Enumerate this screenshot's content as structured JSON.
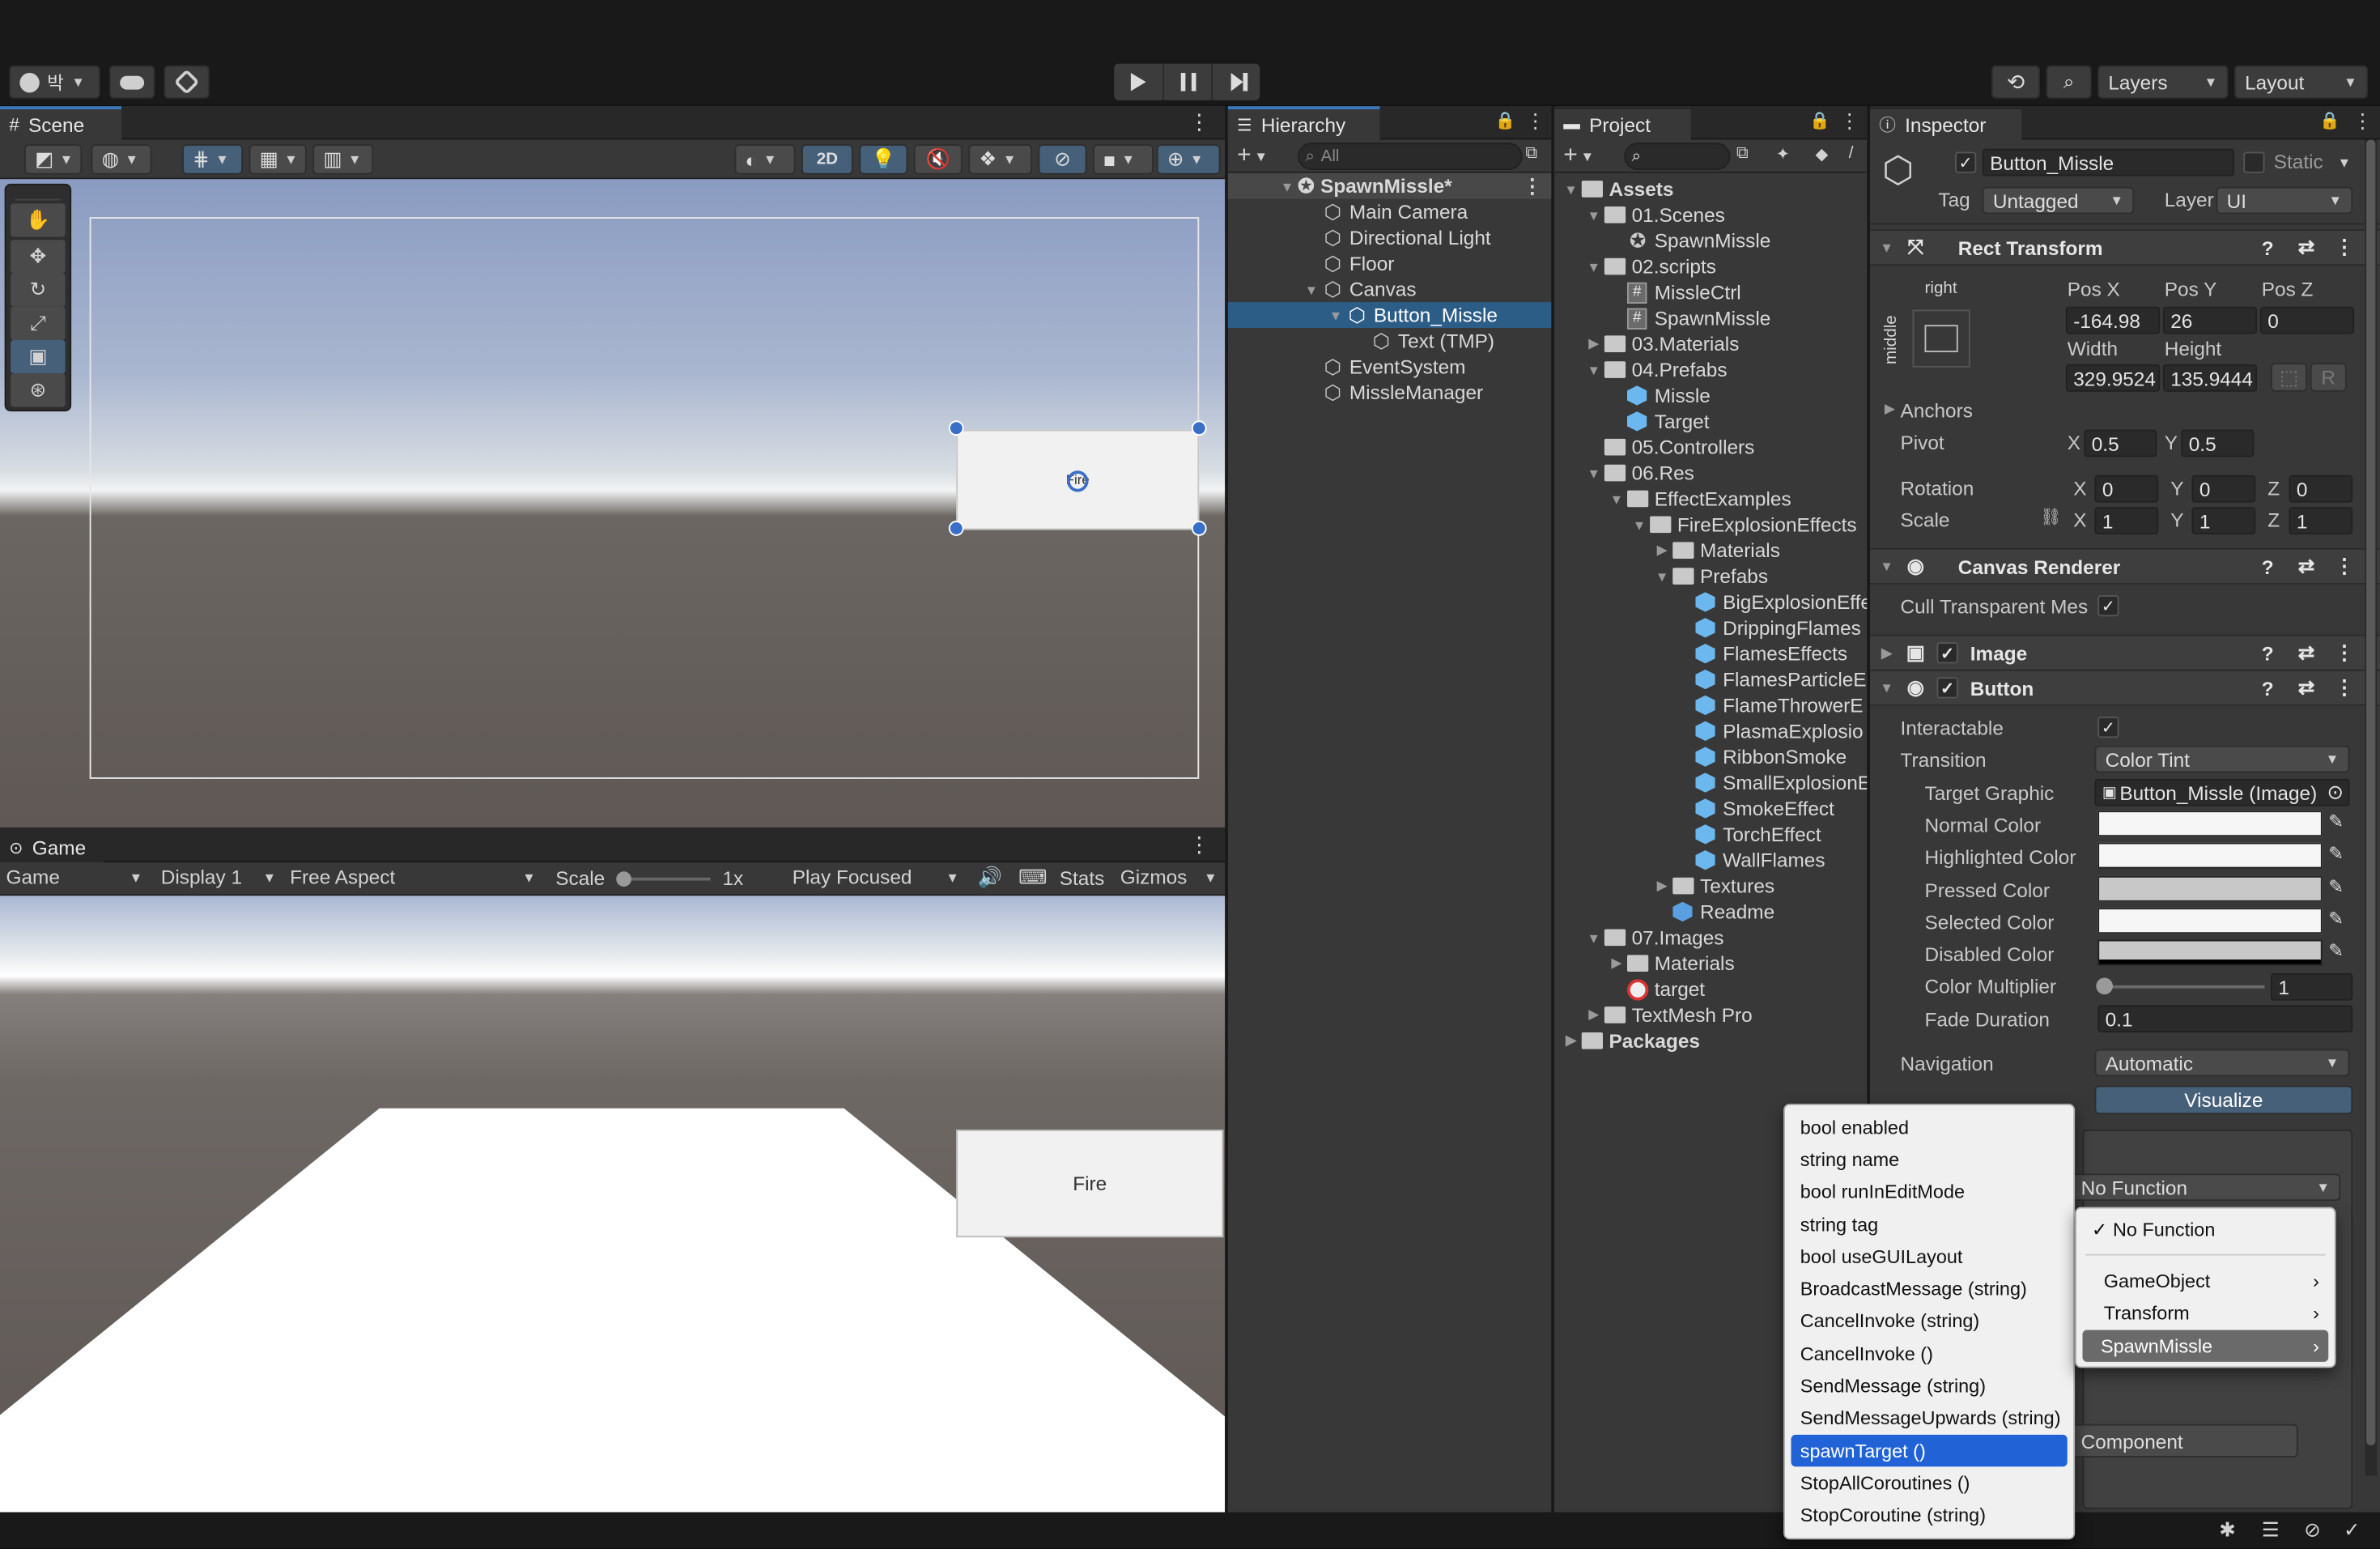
{
  "toolbar": {
    "account_icon": "account-icon",
    "account_label": "박",
    "play": "play-icon",
    "pause": "pause-icon",
    "step": "step-icon",
    "layers": "Layers",
    "layout": "Layout"
  },
  "scene": {
    "tab": "Scene",
    "btn_2d": "2D",
    "button_text": "Fire"
  },
  "game": {
    "tab": "Game",
    "mode": "Game",
    "display": "Display 1",
    "aspect": "Free Aspect",
    "scale_label": "Scale",
    "scale_value": "1x",
    "play_focused": "Play Focused",
    "stats": "Stats",
    "gizmos": "Gizmos",
    "button_text": "Fire"
  },
  "hierarchy": {
    "tab": "Hierarchy",
    "search_placeholder": "All",
    "scene_name": "SpawnMissle*",
    "items": [
      "Main Camera",
      "Directional Light",
      "Floor",
      "Canvas",
      "Button_Missle",
      "Text (TMP)",
      "EventSystem",
      "MissleManager"
    ]
  },
  "project": {
    "tab": "Project",
    "items": [
      "Assets",
      "01.Scenes",
      "SpawnMissle",
      "02.scripts",
      "MissleCtrl",
      "SpawnMissle",
      "03.Materials",
      "04.Prefabs",
      "Missle",
      "Target",
      "05.Controllers",
      "06.Res",
      "EffectExamples",
      "FireExplosionEffects",
      "Materials",
      "Prefabs",
      "BigExplosionEffe",
      "DrippingFlames",
      "FlamesEffects",
      "FlamesParticleE",
      "FlameThrowerE",
      "PlasmaExplosio",
      "RibbonSmoke",
      "SmallExplosionE",
      "SmokeEffect",
      "TorchEffect",
      "WallFlames",
      "Textures",
      "Readme",
      "07.Images",
      "Materials",
      "target",
      "TextMesh Pro",
      "Packages"
    ]
  },
  "inspector": {
    "tab": "Inspector",
    "object_name": "Button_Missle",
    "static_label": "Static",
    "tag_label": "Tag",
    "tag_value": "Untagged",
    "layer_label": "Layer",
    "layer_value": "UI",
    "rect_transform": "Rect Transform",
    "anchor_h": "right",
    "anchor_v": "middle",
    "posx_label": "Pos X",
    "posy_label": "Pos Y",
    "posz_label": "Pos Z",
    "posx": "-164.98",
    "posy": "26",
    "posz": "0",
    "width_label": "Width",
    "height_label": "Height",
    "width": "329.9524",
    "height": "135.9444",
    "r_btn": "R",
    "anchors": "Anchors",
    "pivot": "Pivot",
    "pivot_x": "0.5",
    "pivot_y": "0.5",
    "rotation": "Rotation",
    "rot_x": "0",
    "rot_y": "0",
    "rot_z": "0",
    "scale": "Scale",
    "scale_x": "1",
    "scale_y": "1",
    "scale_z": "1",
    "x": "X",
    "y": "Y",
    "z": "Z",
    "canvas_renderer": "Canvas Renderer",
    "cull": "Cull Transparent Mes",
    "image": "Image",
    "button": "Button",
    "interactable": "Interactable",
    "transition": "Transition",
    "transition_value": "Color Tint",
    "target_graphic": "Target Graphic",
    "target_graphic_value": "Button_Missle (Image)",
    "normal_color": "Normal Color",
    "highlighted_color": "Highlighted Color",
    "pressed_color": "Pressed Color",
    "selected_color": "Selected Color",
    "disabled_color": "Disabled Color",
    "color_multiplier": "Color Multiplier",
    "color_multiplier_value": "1",
    "color_multiplier_level": 0.0,
    "fade_duration": "Fade Duration",
    "fade_duration_value": "0.1",
    "navigation": "Navigation",
    "navigation_value": "Automatic",
    "visualize": "Visualize",
    "function_dropdown": "No Function",
    "add_component": "Component"
  },
  "context_menu": {
    "main": [
      "bool enabled",
      "string name",
      "bool runInEditMode",
      "string tag",
      "bool useGUILayout",
      "BroadcastMessage (string)",
      "CancelInvoke (string)",
      "CancelInvoke ()",
      "SendMessage (string)",
      "SendMessageUpwards (string)",
      "spawnTarget ()",
      "StopAllCoroutines ()",
      "StopCoroutine (string)"
    ],
    "selected_main": "spawnTarget ()",
    "sub_checked": "No Function",
    "sub": [
      "GameObject",
      "Transform",
      "SpawnMissle"
    ],
    "selected_sub": "SpawnMissle"
  },
  "colors": {
    "accent": "#2163d6",
    "selection": "#2c5d87",
    "panel": "#383838",
    "sky_top": "#97a9d0",
    "ground": "#5a534f"
  }
}
